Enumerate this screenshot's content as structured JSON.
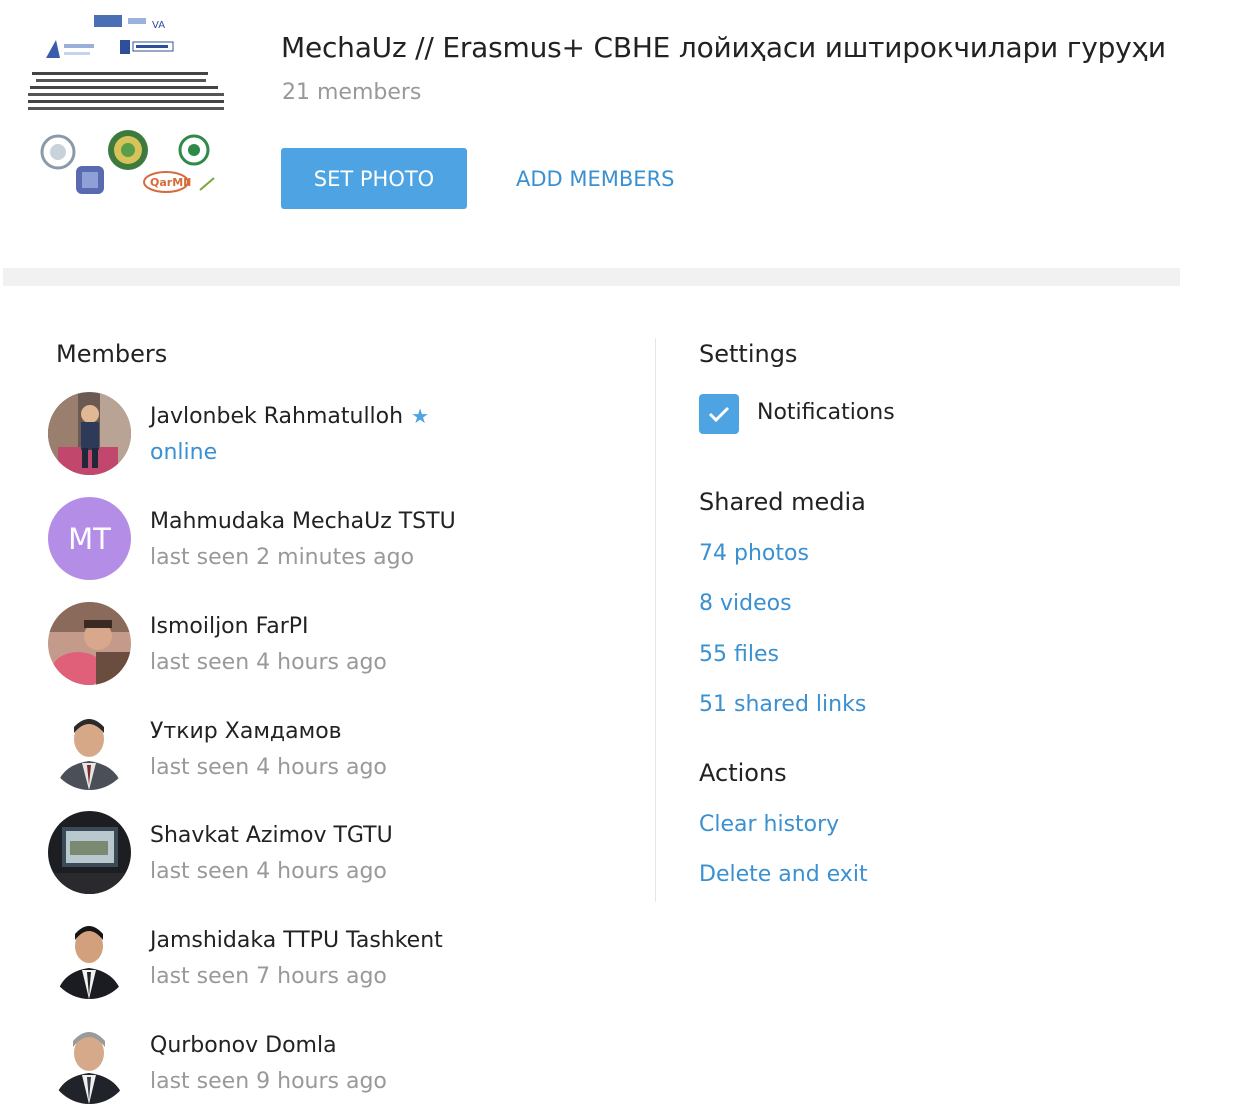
{
  "group": {
    "title": "MechaUz // Erasmus+ CBHE лойиҳаси иштирокчилари гуруҳи",
    "members_count": "21 members",
    "photo_icon": "group-logo-collage"
  },
  "actions": {
    "set_photo": "SET PHOTO",
    "add_members": "ADD MEMBERS"
  },
  "members": {
    "title": "Members",
    "list": [
      {
        "name": "Javlonbek Rahmatulloh",
        "status": "online",
        "admin_icon": "star-icon",
        "avatar": "photo"
      },
      {
        "name": "Mahmudaka MechaUz TSTU",
        "status": "last seen 2 minutes ago",
        "initials": "MT",
        "avatar": "initials"
      },
      {
        "name": "Ismoiljon FarPI",
        "status": "last seen 4 hours ago",
        "avatar": "photo"
      },
      {
        "name": "Уткир Хамдамов",
        "status": "last seen 4 hours ago",
        "avatar": "photo"
      },
      {
        "name": "Shavkat Azimov TGTU",
        "status": "last seen 4 hours ago",
        "avatar": "photo"
      },
      {
        "name": "Jamshidaka TTPU Tashkent",
        "status": "last seen 7 hours ago",
        "avatar": "photo"
      },
      {
        "name": "Qurbonov Domla",
        "status": "last seen 9 hours ago",
        "avatar": "photo"
      }
    ]
  },
  "settings": {
    "title": "Settings",
    "notifications_label": "Notifications",
    "notifications_checked": true
  },
  "shared_media": {
    "title": "Shared media",
    "photos": "74 photos",
    "videos": "8 videos",
    "files": "55 files",
    "links": "51 shared links"
  },
  "actions_section": {
    "title": "Actions",
    "clear_history": "Clear history",
    "delete_and_exit": "Delete and exit"
  },
  "colors": {
    "accent": "#4ea4e2",
    "link": "#3a90d1",
    "muted": "#999999",
    "initials_avatar": "#b48ee6"
  }
}
